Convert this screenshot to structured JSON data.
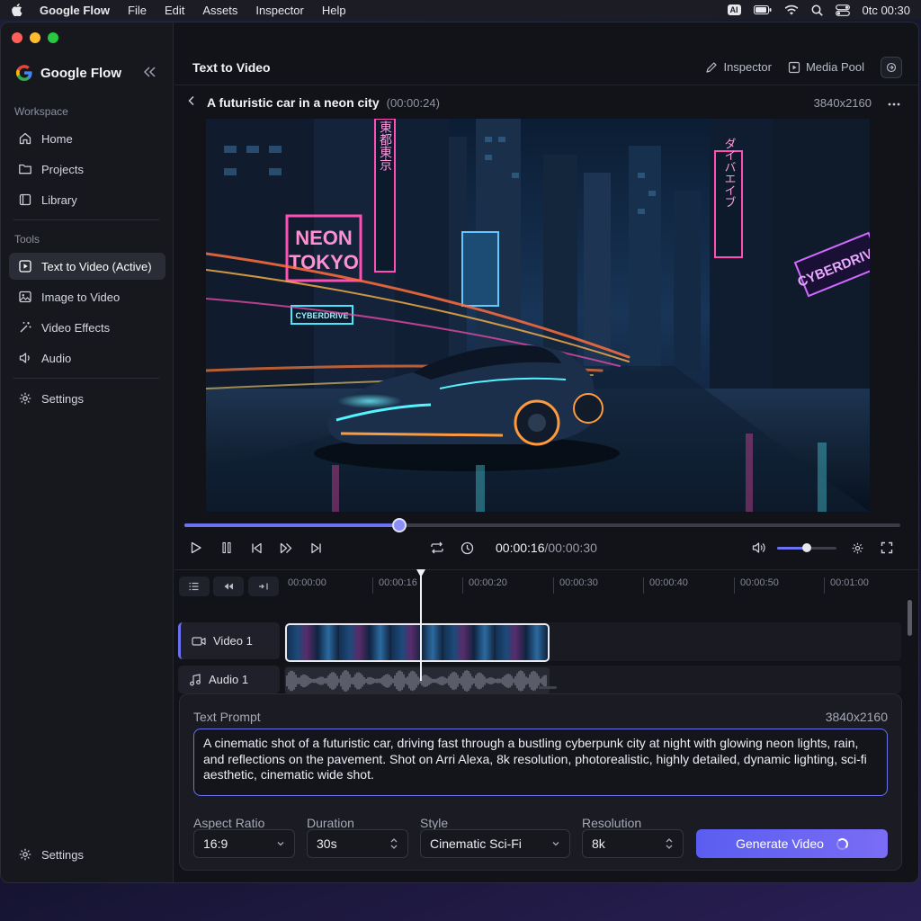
{
  "menubar": {
    "app_name": "Google Flow",
    "menus": [
      "File",
      "Edit",
      "Assets",
      "Inspector",
      "Help"
    ],
    "ai_badge": "AI",
    "clock": "0tc 00:30"
  },
  "sidebar": {
    "brand": "Google Flow",
    "workspace_label": "Workspace",
    "workspace_items": [
      {
        "label": "Home",
        "icon": "home-icon"
      },
      {
        "label": "Projects",
        "icon": "folder-icon"
      },
      {
        "label": "Library",
        "icon": "book-icon"
      }
    ],
    "tools_label": "Tools",
    "tools_items": [
      {
        "label": "Text to Video (Active)",
        "icon": "play-square-icon",
        "active": true
      },
      {
        "label": "Image to Video",
        "icon": "image-icon"
      },
      {
        "label": "Video Effects",
        "icon": "magic-wand-icon"
      },
      {
        "label": "Audio",
        "icon": "speaker-icon"
      }
    ],
    "settings_label": "Settings",
    "bottom_settings_label": "Settings"
  },
  "topbar": {
    "title": "Text to Video",
    "inspector_label": "Inspector",
    "media_pool_label": "Media Pool"
  },
  "clip": {
    "title": "A futuristic car in a neon city",
    "duration": "(00:00:24)",
    "resolution": "3840x2160"
  },
  "preview": {
    "signs": [
      "NEON",
      "TOKYO",
      "CYBERDRIVE",
      "CYBERDRIVE",
      "東都東京",
      "ダイバエイブ"
    ]
  },
  "playback": {
    "current_time": "00:00:16",
    "total_time": "/00:00:30",
    "progress": 0.3,
    "volume": 0.5
  },
  "timeline": {
    "ticks": [
      "00:00:00",
      "00:00:16",
      "00:00:20",
      "00:00:30",
      "00:00:40",
      "00:00:50",
      "00:01:00"
    ],
    "tracks": [
      {
        "label": "Video 1",
        "icon": "video-camera-icon"
      },
      {
        "label": "Audio 1",
        "icon": "music-note-icon"
      }
    ]
  },
  "prompt": {
    "label": "Text Prompt",
    "resolution": "3840x2160",
    "text": "A cinematic shot of a futuristic car, driving fast through a bustling cyberpunk city at night with glowing neon lights, rain, and reflections on the pavement. Shot on Arri Alexa, 8k resolution, photorealistic, highly detailed, dynamic lighting, sci-fi aesthetic, cinematic wide shot."
  },
  "options": {
    "aspect_ratio": {
      "label": "Aspect Ratio",
      "value": "16:9"
    },
    "duration": {
      "label": "Duration",
      "value": "30s"
    },
    "style": {
      "label": "Style",
      "value": "Cinematic Sci-Fi"
    },
    "resolution": {
      "label": "Resolution",
      "value": "8k"
    },
    "generate_label": "Generate Video"
  },
  "colors": {
    "accent": "#6c72f2",
    "background": "#121318",
    "sidebar": "#17181e"
  }
}
